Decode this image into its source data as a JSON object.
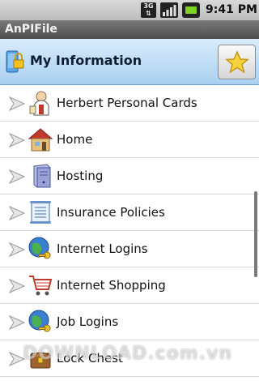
{
  "status_bar": {
    "network": "3G",
    "time": "9:41 PM"
  },
  "app": {
    "title": "AnPIFile"
  },
  "header": {
    "title": "My Information"
  },
  "items": [
    {
      "label": "Herbert Personal Cards",
      "icon": "person-card-icon"
    },
    {
      "label": "Home",
      "icon": "house-icon"
    },
    {
      "label": "Hosting",
      "icon": "server-icon"
    },
    {
      "label": "Insurance Policies",
      "icon": "document-scroll-icon"
    },
    {
      "label": "Internet Logins",
      "icon": "globe-key-icon"
    },
    {
      "label": "Internet Shopping",
      "icon": "shopping-cart-icon"
    },
    {
      "label": "Job Logins",
      "icon": "globe-key-icon"
    },
    {
      "label": "Lock Chest",
      "icon": "lock-chest-icon"
    }
  ],
  "watermark": "DOWNLOAD.com.vn",
  "colors": {
    "header_bg": "#bcdcf6",
    "title_bar_bg": "#5e5e5e"
  }
}
